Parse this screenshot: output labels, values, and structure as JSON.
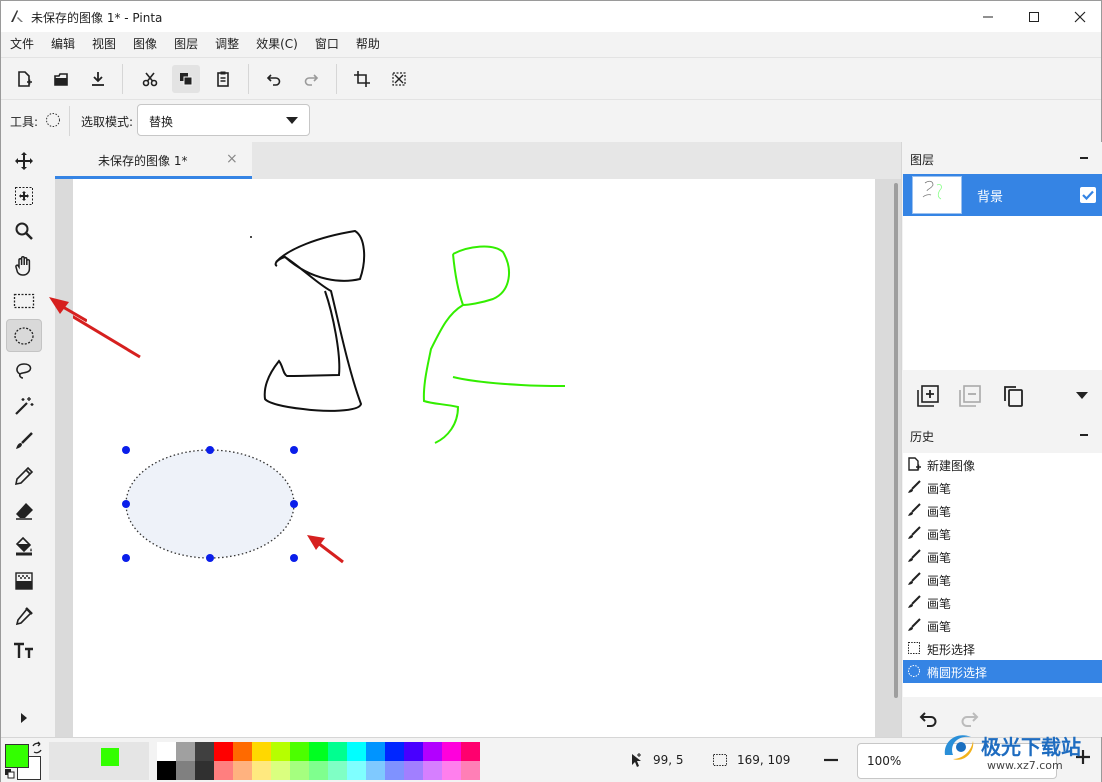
{
  "window": {
    "title": "未保存的图像 1* - Pinta",
    "controls": [
      "minimize",
      "maximize",
      "close"
    ]
  },
  "menu": [
    "文件",
    "编辑",
    "视图",
    "图像",
    "图层",
    "调整",
    "效果(C)",
    "窗口",
    "帮助"
  ],
  "toolbar": {
    "buttons": [
      "new-image-icon",
      "open-icon",
      "save-icon",
      "cut-icon",
      "copy-icon",
      "paste-icon",
      "undo-icon",
      "redo-icon",
      "crop-icon",
      "deselect-icon"
    ]
  },
  "options": {
    "tool_label": "工具:",
    "mode_label": "选取模式:",
    "mode_value": "替换"
  },
  "tools": [
    "move-selected-icon",
    "move-selection-icon",
    "zoom-icon",
    "pan-icon",
    "rectangle-select-icon",
    "ellipse-select-icon",
    "lasso-select-icon",
    "magic-wand-icon",
    "paintbrush-icon",
    "pencil-icon",
    "eraser-icon",
    "paint-bucket-icon",
    "gradient-icon",
    "color-picker-icon",
    "text-icon"
  ],
  "active_tool": "ellipse-select-icon",
  "document_tab": {
    "label": "未保存的图像 1*",
    "close": "×"
  },
  "layers": {
    "header": "图层",
    "items": [
      {
        "name": "背景",
        "visible": true
      }
    ]
  },
  "history": {
    "header": "历史",
    "items": [
      {
        "label": "新建图像",
        "icon": "new-image-icon"
      },
      {
        "label": "画笔",
        "icon": "paintbrush-icon"
      },
      {
        "label": "画笔",
        "icon": "paintbrush-icon"
      },
      {
        "label": "画笔",
        "icon": "paintbrush-icon"
      },
      {
        "label": "画笔",
        "icon": "paintbrush-icon"
      },
      {
        "label": "画笔",
        "icon": "paintbrush-icon"
      },
      {
        "label": "画笔",
        "icon": "paintbrush-icon"
      },
      {
        "label": "画笔",
        "icon": "paintbrush-icon"
      },
      {
        "label": "矩形选择",
        "icon": "rectangle-select-icon"
      },
      {
        "label": "椭圆形选择",
        "icon": "ellipse-select-icon"
      }
    ],
    "selected_index": 9
  },
  "status": {
    "cursor_position": "99, 5",
    "selection_size": "169, 109",
    "zoom": "100%"
  },
  "colors": {
    "primary": "#33ff00",
    "secondary": "#ffffff",
    "recent": "#33ff00",
    "accent": "#3584e4",
    "palette_top": [
      "#ffffff",
      "#a0a0a0",
      "#404040",
      "#ff0000",
      "#ff6a00",
      "#ffd800",
      "#b6ff00",
      "#4cff00",
      "#00ff21",
      "#00ff90",
      "#00ffff",
      "#0094ff",
      "#0026ff",
      "#4800ff",
      "#b200ff",
      "#ff00dc",
      "#ff006e"
    ],
    "palette_bottom": [
      "#000000",
      "#808080",
      "#303030",
      "#ff7f7f",
      "#ffb27f",
      "#ffe97f",
      "#daff7f",
      "#a5ff7f",
      "#7fff8e",
      "#7fffc5",
      "#7fffff",
      "#7fc9ff",
      "#7f92ff",
      "#a17fff",
      "#d67fff",
      "#ff7fed",
      "#ff7fb6"
    ]
  },
  "watermark": {
    "text": "极光下载站",
    "url_text": "www.xz7.com"
  }
}
